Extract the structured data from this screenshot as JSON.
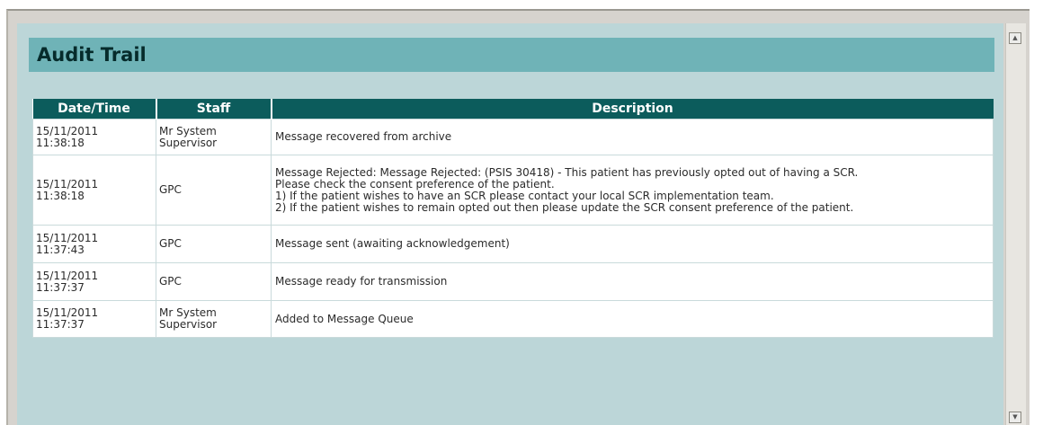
{
  "panel": {
    "title": "Audit Trail"
  },
  "table": {
    "headers": [
      "Date/Time",
      "Staff",
      "Description"
    ],
    "rows": [
      {
        "date": "15/11/2011",
        "time": "11:38:18",
        "staff": [
          "Mr System",
          "Supervisor"
        ],
        "description": [
          "Message recovered from archive"
        ]
      },
      {
        "date": "15/11/2011",
        "time": "11:38:18",
        "staff": [
          "GPC"
        ],
        "description": [
          "Message Rejected: Message Rejected: (PSIS 30418) - This patient has previously opted out of having a SCR.",
          "Please check the consent preference of the patient.",
          "1) If the patient wishes to have an SCR please contact your local SCR implementation team.",
          "2) If the patient wishes to remain opted out then please update the SCR consent preference of the patient."
        ]
      },
      {
        "date": "15/11/2011",
        "time": "11:37:43",
        "staff": [
          "GPC"
        ],
        "description": [
          "Message sent (awaiting acknowledgement)"
        ]
      },
      {
        "date": "15/11/2011",
        "time": "11:37:37",
        "staff": [
          "GPC"
        ],
        "description": [
          "Message ready for transmission"
        ]
      },
      {
        "date": "15/11/2011",
        "time": "11:37:37",
        "staff": [
          "Mr System",
          "Supervisor"
        ],
        "description": [
          "Added to Message Queue"
        ]
      }
    ]
  },
  "scrollbar": {
    "up_icon": "scroll-up-arrow-icon",
    "down_icon": "scroll-down-arrow-icon",
    "up_glyph": "▲",
    "down_glyph": "▼"
  }
}
